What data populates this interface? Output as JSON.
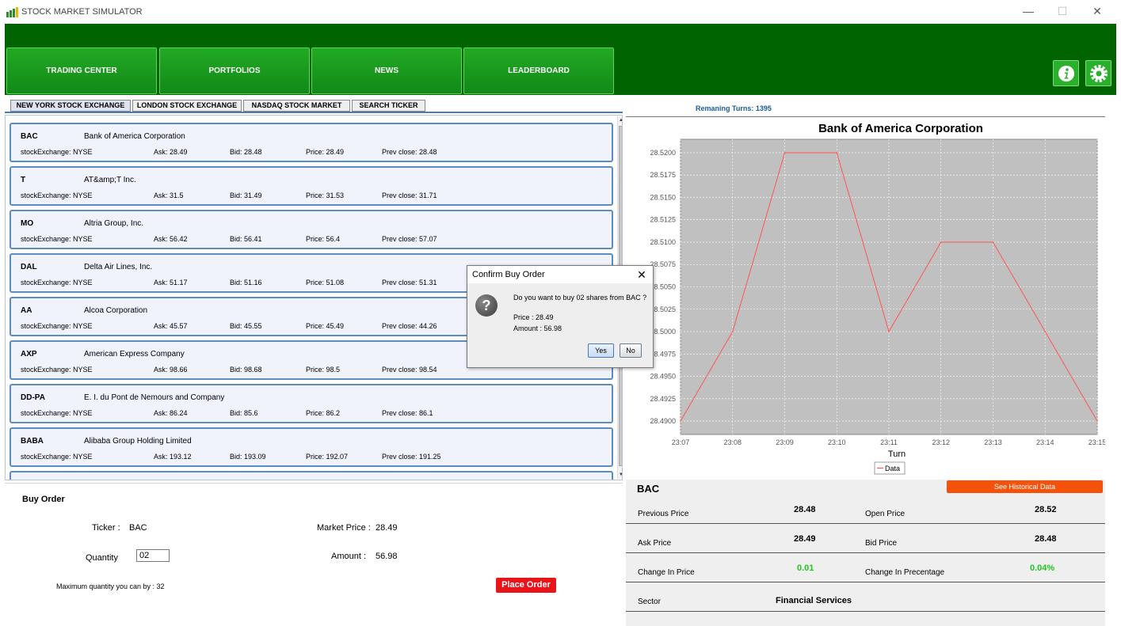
{
  "window": {
    "title": "STOCK MARKET SIMULATOR",
    "controls": [
      "—",
      "☐",
      "✕"
    ]
  },
  "nav": {
    "buttons": [
      "TRADING CENTER",
      "PORTFOLIOS",
      "NEWS",
      "LEADERBOARD"
    ],
    "icons": [
      "info-icon",
      "settings-gear-icon"
    ]
  },
  "exchange_tabs": [
    "NEW YORK STOCK EXCHANGE",
    "LONDON STOCK EXCHANGE",
    "NASDAQ STOCK MARKET",
    "SEARCH TICKER"
  ],
  "stocks": [
    {
      "symbol": "BAC",
      "name": "Bank of America Corporation",
      "exchange": "stockExchange: NYSE",
      "ask": "Ask: 28.49",
      "bid": "Bid: 28.48",
      "price": "Price: 28.49",
      "prev": "Prev close: 28.48"
    },
    {
      "symbol": "T",
      "name": "AT&amp;T Inc.",
      "exchange": "stockExchange: NYSE",
      "ask": "Ask: 31.5",
      "bid": "Bid: 31.49",
      "price": "Price: 31.53",
      "prev": "Prev close: 31.71"
    },
    {
      "symbol": "MO",
      "name": "Altria Group, Inc.",
      "exchange": "stockExchange: NYSE",
      "ask": "Ask: 56.42",
      "bid": "Bid: 56.41",
      "price": "Price: 56.4",
      "prev": "Prev close: 57.07"
    },
    {
      "symbol": "DAL",
      "name": "Delta Air Lines, Inc.",
      "exchange": "stockExchange: NYSE",
      "ask": "Ask: 51.17",
      "bid": "Bid: 51.16",
      "price": "Price: 51.08",
      "prev": "Prev close: 51.31"
    },
    {
      "symbol": "AA",
      "name": "Alcoa Corporation",
      "exchange": "stockExchange: NYSE",
      "ask": "Ask: 45.57",
      "bid": "Bid: 45.55",
      "price": "Price: 45.49",
      "prev": "Prev close: 44.26"
    },
    {
      "symbol": "AXP",
      "name": "American Express Company",
      "exchange": "stockExchange: NYSE",
      "ask": "Ask: 98.66",
      "bid": "Bid: 98.68",
      "price": "Price: 98.5",
      "prev": "Prev close: 98.54"
    },
    {
      "symbol": "DD-PA",
      "name": "E. I. du Pont de Nemours and Company",
      "exchange": "stockExchange: NYSE",
      "ask": "Ask: 86.24",
      "bid": "Bid: 85.6",
      "price": "Price: 86.2",
      "prev": "Prev close: 86.1"
    },
    {
      "symbol": "BABA",
      "name": "Alibaba Group Holding Limited",
      "exchange": "stockExchange: NYSE",
      "ask": "Ask: 193.12",
      "bid": "Bid: 193.09",
      "price": "Price: 192.07",
      "prev": "Prev close: 191.25"
    }
  ],
  "buy_order": {
    "heading": "Buy Order",
    "ticker_label": "Ticker :",
    "ticker_value": "BAC",
    "quantity_label": "Quantity",
    "quantity_value": "02",
    "market_price_label": "Market Price :",
    "market_price_value": "28.49",
    "amount_label": "Amount :",
    "amount_value": "56.98",
    "max_quantity": "Maximum quantity you can by : 32",
    "place_order": "Place Order"
  },
  "remaining_turns": "Remaning Turns: 1395",
  "chart_data": {
    "type": "line",
    "title": "Bank of America Corporation",
    "xlabel": "Turn",
    "ylabel": "",
    "categories": [
      "23:07",
      "23:08",
      "23:09",
      "23:10",
      "23:11",
      "23:12",
      "23:13",
      "23:14",
      "23:15"
    ],
    "series": [
      {
        "name": "Data",
        "values": [
          28.49,
          28.5,
          28.52,
          28.52,
          28.5,
          28.51,
          28.51,
          28.5,
          28.49
        ]
      }
    ],
    "ylim": [
      28.4885,
      28.5215
    ],
    "yticks": [
      "28.4900",
      "28.4925",
      "28.4950",
      "28.4975",
      "28.5000",
      "28.5025",
      "28.5050",
      "28.5075",
      "28.5100",
      "28.5125",
      "28.5150",
      "28.5175",
      "28.5200"
    ],
    "grid": true,
    "legend": "bottom",
    "colors": {
      "line": "#ff5555",
      "plot_bg": "#c0c0c0"
    }
  },
  "details": {
    "symbol": "BAC",
    "historical_button": "See Historical Data",
    "rows": [
      {
        "k1": "Previous Price",
        "v1": "28.48",
        "k2": "Open Price",
        "v2": "28.52"
      },
      {
        "k1": "Ask Price",
        "v1": "28.49",
        "k2": "Bid Price",
        "v2": "28.48"
      },
      {
        "k1": "Change In Price",
        "v1": "0.01",
        "k2": "Change In Precentage",
        "v2": "0.04%"
      },
      {
        "k1": "Sector",
        "v1": "Financial Services",
        "k2": "",
        "v2": ""
      }
    ]
  },
  "dialog": {
    "title": "Confirm Buy Order",
    "question": "Do you want to buy 02 shares from BAC ?",
    "price": "Price : 28.49",
    "amount": "Amount : 56.98",
    "yes": "Yes",
    "no": "No"
  },
  "colors": {
    "menubar": "#006400",
    "nav_button": "#1a9a1a",
    "place_order": "#e8141a",
    "historical_button": "#f4510a",
    "positive": "#1ec61e"
  }
}
